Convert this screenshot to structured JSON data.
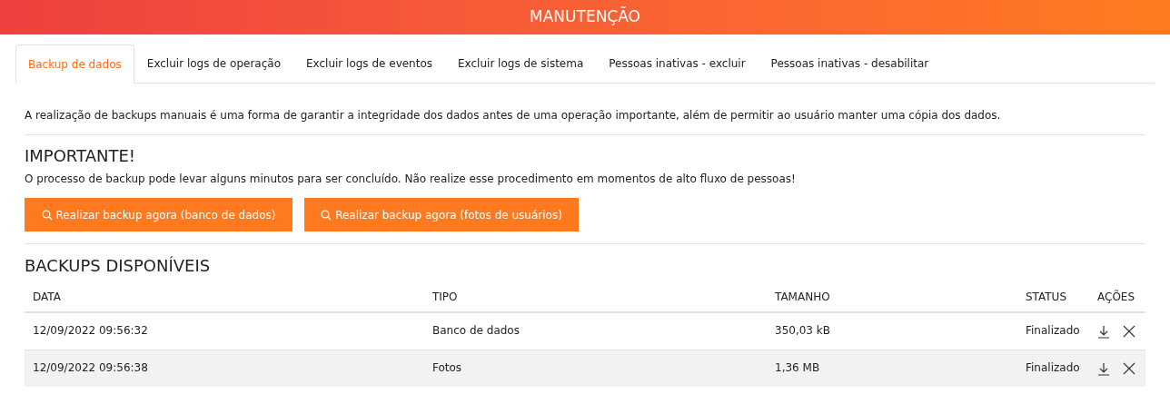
{
  "header": {
    "title": "MANUTENÇÃO"
  },
  "tabs": [
    {
      "label": "Backup de dados",
      "selected": true
    },
    {
      "label": "Excluir logs de operação",
      "selected": false
    },
    {
      "label": "Excluir logs de eventos",
      "selected": false
    },
    {
      "label": "Excluir logs de sistema",
      "selected": false
    },
    {
      "label": "Pessoas inativas - excluir",
      "selected": false
    },
    {
      "label": "Pessoas inativas - desabilitar",
      "selected": false
    }
  ],
  "intro": "A realização de backups manuais é uma forma de garantir a integridade dos dados antes de uma operação importante, além de permitir ao usuário manter uma cópia dos dados.",
  "warning": {
    "title": "IMPORTANTE!",
    "text": "O processo de backup pode levar alguns minutos para ser concluído. Não realize esse procedimento em momentos de alto fluxo de pessoas!"
  },
  "buttons": [
    "Realizar backup agora (banco de dados)",
    "Realizar backup agora (fotos de usuários)"
  ],
  "backups": {
    "title": "BACKUPS DISPONÍVEIS",
    "columns": [
      "DATA",
      "TIPO",
      "TAMANHO",
      "STATUS",
      "AÇÕES"
    ],
    "rows": [
      {
        "cells": [
          "12/09/2022 09:56:32",
          "Banco de dados",
          "350,03 kB",
          "Finalizado"
        ]
      },
      {
        "cells": [
          "12/09/2022 09:56:38",
          "Fotos",
          "1,36 MB",
          "Finalizado"
        ]
      }
    ]
  }
}
